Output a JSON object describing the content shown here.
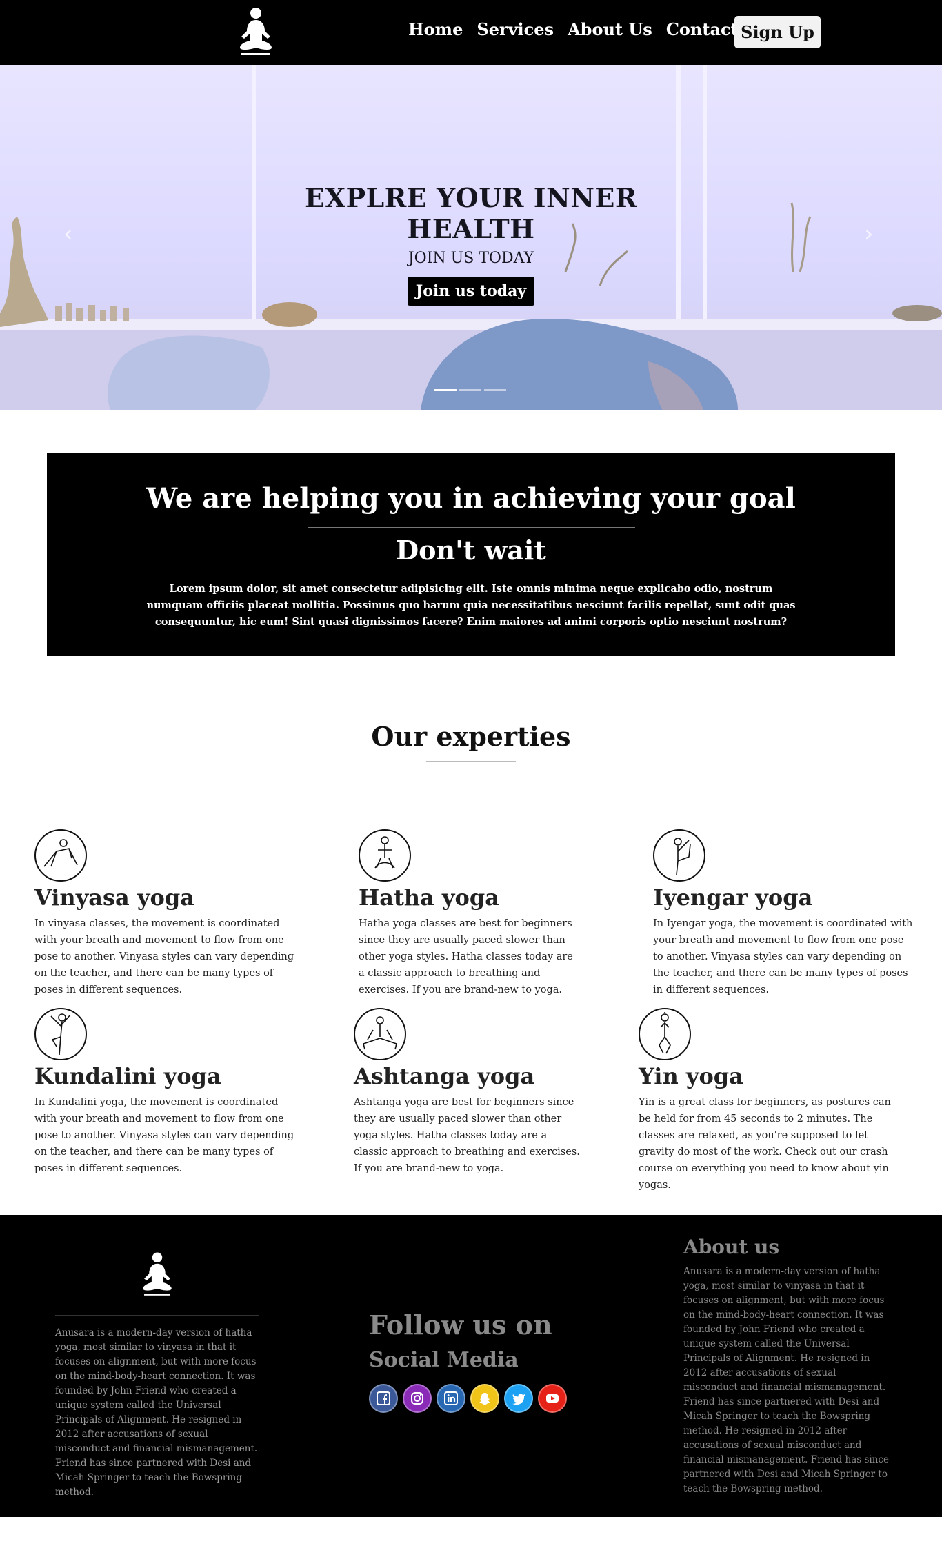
{
  "nav": {
    "logo_icon": "meditating-person-icon",
    "links": [
      "Home",
      "Services",
      "About Us",
      "Contact Us"
    ],
    "signup_label": "Sign Up"
  },
  "hero": {
    "title_line1": "EXPLRE YOUR INNER",
    "title_line2": "HEALTH",
    "subtitle": "JOIN US TODAY",
    "button_label": "Join us today",
    "prev_icon": "chevron-left-icon",
    "next_icon": "chevron-right-icon",
    "slides": 3,
    "active_slide": 0
  },
  "goal": {
    "title": "We are helping you in achieving your goal",
    "subtitle": "Don't wait",
    "text": "Lorem ipsum dolor, sit amet consectetur adipisicing elit. Iste omnis minima neque explicabo odio, nostrum numquam officiis placeat mollitia. Possimus quo harum quia necessitatibus nesciunt facilis repellat, sunt odit quas consequuntur, hic eum! Sint quasi dignissimos facere? Enim maiores ad animi corporis optio nesciunt nostrum?"
  },
  "expertise": {
    "heading": "Our experties",
    "cards": [
      {
        "icon": "vinyasa-pose-icon",
        "title": "Vinyasa yoga",
        "text": "In vinyasa classes, the movement is coordinated with your breath and movement to flow from one pose to another. Vinyasa styles can vary depending on the teacher, and there can be many types of poses in different sequences."
      },
      {
        "icon": "hatha-pose-icon",
        "title": "Hatha yoga",
        "text": "Hatha yoga classes are best for beginners since they are usually paced slower than other yoga styles. Hatha classes today are a classic approach to breathing and exercises. If you are brand-new to yoga."
      },
      {
        "icon": "iyengar-pose-icon",
        "title": "Iyengar yoga",
        "text": "In Iyengar yoga, the movement is coordinated with your breath and movement to flow from one pose to another. Vinyasa styles can vary depending on the teacher, and there can be many types of poses in different sequences."
      },
      {
        "icon": "kundalini-pose-icon",
        "title": "Kundalini yoga",
        "text": "In Kundalini yoga, the movement is coordinated with your breath and movement to flow from one pose to another. Vinyasa styles can vary depending on the teacher, and there can be many types of poses in different sequences."
      },
      {
        "icon": "ashtanga-pose-icon",
        "title": "Ashtanga yoga",
        "text": "Ashtanga yoga are best for beginners since they are usually paced slower than other yoga styles. Hatha classes today are a classic approach to breathing and exercises. If you are brand-new to yoga."
      },
      {
        "icon": "yin-pose-icon",
        "title": "Yin yoga",
        "text": "Yin is a great class for beginners, as postures can be held for from 45 seconds to 2 minutes. The classes are relaxed, as you're supposed to let gravity do most of the work. Check out our crash course on everything you need to know about yin yogas."
      }
    ]
  },
  "footer": {
    "logo_icon": "meditating-person-icon",
    "left_text": "Anusara is a modern-day version of hatha yoga, most similar to vinyasa in that it focuses on alignment, but with more focus on the mind-body-heart connection. It was founded by John Friend who created a unique system called the Universal Principals of Alignment. He resigned in 2012 after accusations of sexual misconduct and financial mismanagement. Friend has since partnered with Desi and Micah Springer to teach the Bowspring method.",
    "follow_title": "Follow us on",
    "follow_sub": "Social Media",
    "socials": [
      {
        "icon": "facebook-icon",
        "color": "#3b5998"
      },
      {
        "icon": "instagram-icon",
        "color": "#8a2bb8"
      },
      {
        "icon": "linkedin-icon",
        "color": "#2867b2"
      },
      {
        "icon": "snapchat-icon",
        "color": "#f0c419"
      },
      {
        "icon": "twitter-icon",
        "color": "#1da1f2"
      },
      {
        "icon": "youtube-icon",
        "color": "#e62117"
      }
    ],
    "about_title": "About us",
    "about_text": "Anusara is a modern-day version of hatha yoga, most similar to vinyasa in that it focuses on alignment, but with more focus on the mind-body-heart connection. It was founded by John Friend who created a unique system called the Universal Principals of Alignment. He resigned in 2012 after accusations of sexual misconduct and financial mismanagement. Friend has since partnered with Desi and Micah Springer to teach the Bowspring method. He resigned in 2012 after accusations of sexual misconduct and financial mismanagement. Friend has since partnered with Desi and Micah Springer to teach the Bowspring method."
  }
}
